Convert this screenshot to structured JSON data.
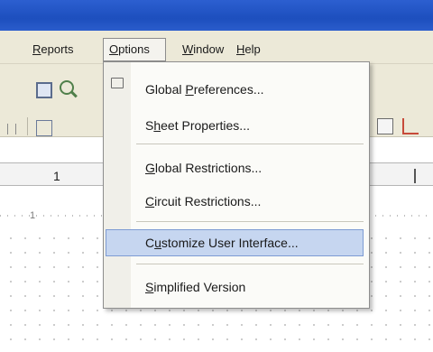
{
  "menubar": {
    "reports": {
      "pre": "",
      "u": "R",
      "post": "eports"
    },
    "options": {
      "pre": "",
      "u": "O",
      "post": "ptions"
    },
    "window": {
      "pre": "",
      "u": "W",
      "post": "indow"
    },
    "help": {
      "pre": "",
      "u": "H",
      "post": "elp"
    }
  },
  "ruler": {
    "label": "1",
    "dotted_label": "1"
  },
  "dropdown": {
    "items": [
      {
        "pre": "Global ",
        "u": "P",
        "post": "references..."
      },
      {
        "pre": "S",
        "u": "h",
        "post": "eet Properties..."
      },
      {
        "pre": "",
        "u": "G",
        "post": "lobal Restrictions..."
      },
      {
        "pre": "",
        "u": "C",
        "post": "ircuit Restrictions..."
      },
      {
        "pre": "C",
        "u": "u",
        "post": "stomize User Interface..."
      },
      {
        "pre": "",
        "u": "S",
        "post": "implified Version"
      }
    ],
    "highlight_color": "#c6d6f0"
  },
  "colors": {
    "titlebar": "#2c5fd0",
    "chrome": "#ece9d8"
  }
}
